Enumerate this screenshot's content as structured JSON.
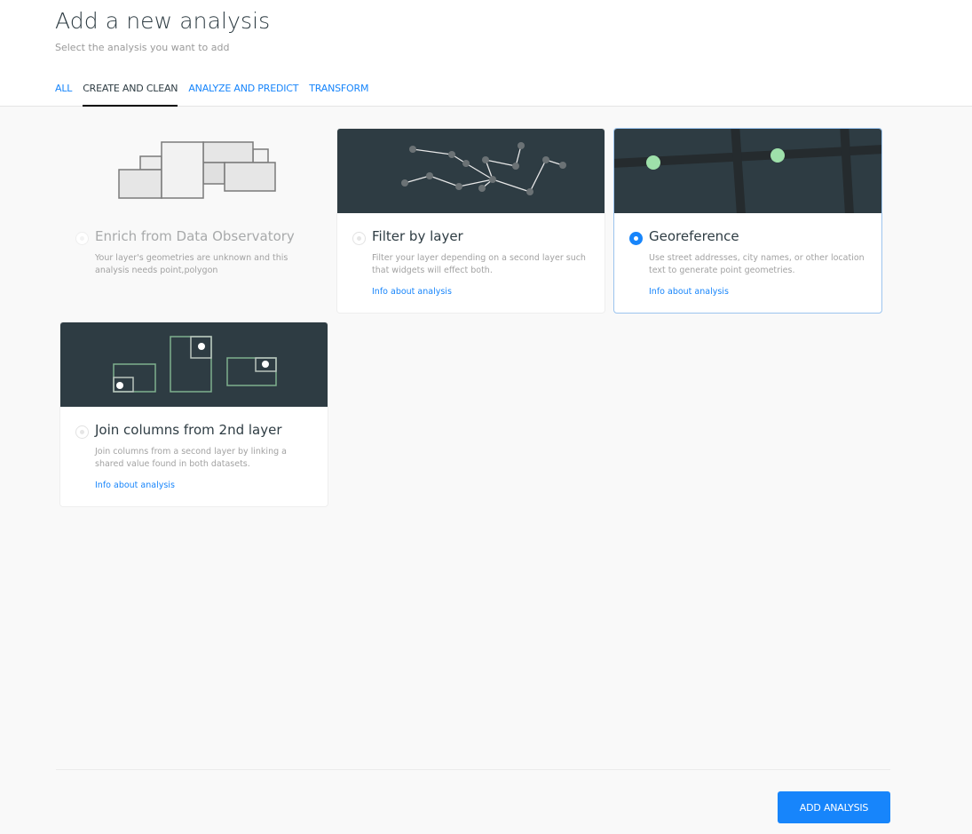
{
  "header": {
    "title": "Add a new analysis",
    "subtitle": "Select the analysis you want to add"
  },
  "tabs": [
    {
      "label": "ALL",
      "active": false
    },
    {
      "label": "CREATE AND CLEAN",
      "active": true
    },
    {
      "label": "ANALYZE AND PREDICT",
      "active": false
    },
    {
      "label": "TRANSFORM",
      "active": false
    }
  ],
  "analyses": [
    {
      "name": "Enrich from Data Observatory",
      "description": "Your layer's geometries are unknown and this analysis needs point,polygon",
      "disabled": true,
      "selected": false,
      "illustration": "overlapping-polygons"
    },
    {
      "name": "Filter by layer",
      "description": "Filter your layer depending on a second layer such that widgets will effect both.",
      "info_link": "Info about analysis",
      "disabled": false,
      "selected": false,
      "illustration": "connected-nodes"
    },
    {
      "name": "Georeference",
      "description": "Use street addresses, city names, or other location text to generate point geometries.",
      "info_link": "Info about analysis",
      "disabled": false,
      "selected": true,
      "illustration": "street-map-points"
    },
    {
      "name": "Join columns from 2nd layer",
      "description": "Join columns from a second layer by linking a shared value found in both datasets.",
      "info_link": "Info about analysis",
      "disabled": false,
      "selected": false,
      "illustration": "joined-boxes"
    }
  ],
  "footer": {
    "add_button": "ADD ANALYSIS"
  },
  "colors": {
    "accent": "#1785fb",
    "illustration_bg": "#2e3c43",
    "point_green": "#9ee0aa",
    "box_green": "#7fb08e"
  }
}
